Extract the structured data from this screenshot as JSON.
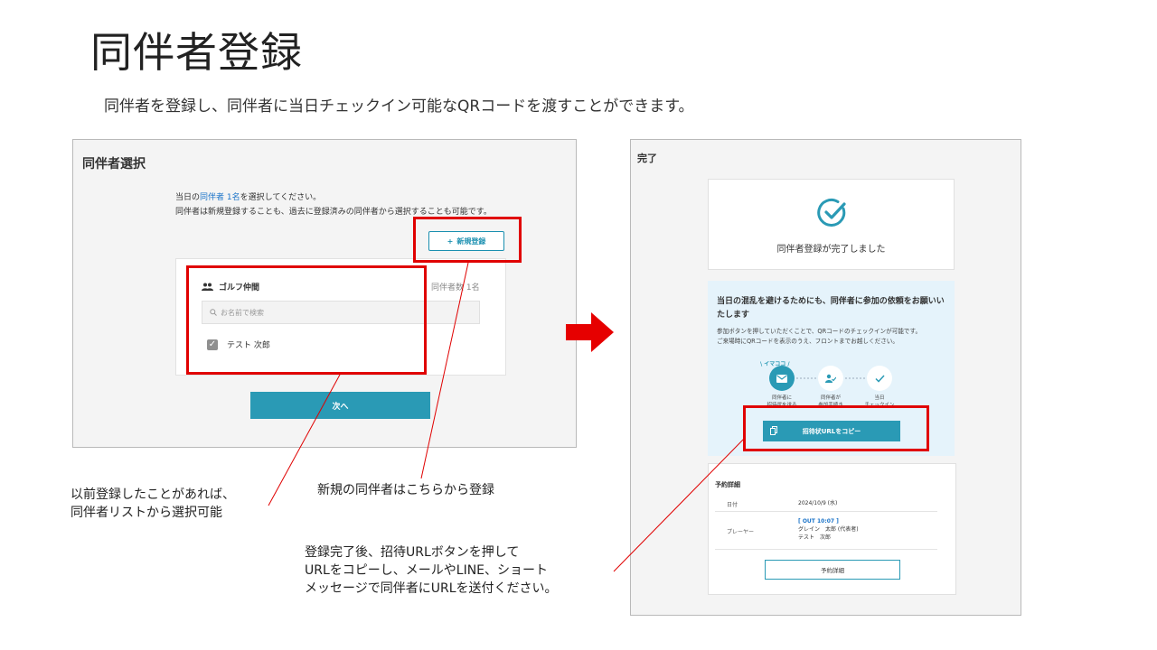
{
  "slide": {
    "title": "同伴者登録",
    "subtitle": "同伴者を登録し、同伴者に当日チェックイン可能なQRコードを渡すことができます。"
  },
  "left_screen": {
    "heading": "同伴者選択",
    "instruction_prefix": "当日の",
    "instruction_highlight": "同伴者 1名",
    "instruction_suffix": "を選択してください。",
    "instruction_line2": "同伴者は新規登録することも、過去に登録済みの同伴者から選択することも可能です。",
    "new_button_label": "新規登録",
    "group": {
      "name": "ゴルフ仲間",
      "count_label": "同伴者数 1名",
      "search_placeholder": "お名前で検索",
      "members": [
        {
          "name": "テスト 次郎",
          "checked": true
        }
      ]
    },
    "next_button_label": "次へ"
  },
  "right_screen": {
    "step_label": "完了",
    "completion_message": "同伴者登録が完了しました",
    "invite_title": "当日の混乱を避けるためにも、同伴者に参加の依頼をお願いいたします",
    "invite_desc_line1": "参加ボタンを押していただくことで、QRコードのチェックインが可能です。",
    "invite_desc_line2": "ご来場時にQRコードを表示のうえ、フロントまでお越しください。",
    "now_badge": "イマココ",
    "steps": [
      {
        "label_line1": "同伴者に",
        "label_line2": "招待状を送る",
        "icon": "mail-icon"
      },
      {
        "label_line1": "同伴者が",
        "label_line2": "参加手続き",
        "icon": "person-check-icon"
      },
      {
        "label_line1": "当日",
        "label_line2": "チェックイン",
        "icon": "check-icon"
      }
    ],
    "copy_button_label": "招待状URLをコピー",
    "details": {
      "title": "予約詳細",
      "date_label": "日付",
      "date_value": "2024/10/9 (水)",
      "player_label": "プレーヤー",
      "tee_time": "[ OUT 10:07 ]",
      "player1": "グレイン　太郎 (代表者)",
      "player2": "テスト　次郎",
      "detail_button_label": "予約詳細"
    }
  },
  "annotations": {
    "note_left_line1": "以前登録したことがあれば、",
    "note_left_line2": "同伴者リストから選択可能",
    "note_middle": "新規の同伴者はこちらから登録",
    "note_right_line1": "登録完了後、招待URLボタンを押して",
    "note_right_line2": "URLをコピーし、メールやLINE、ショート",
    "note_right_line3": "メッセージで同伴者にURLを送付ください。"
  },
  "colors": {
    "accent": "#2a9ab5",
    "highlight_box": "#e00000",
    "link": "#1a73c8",
    "invite_panel_bg": "#e5f3fb"
  }
}
